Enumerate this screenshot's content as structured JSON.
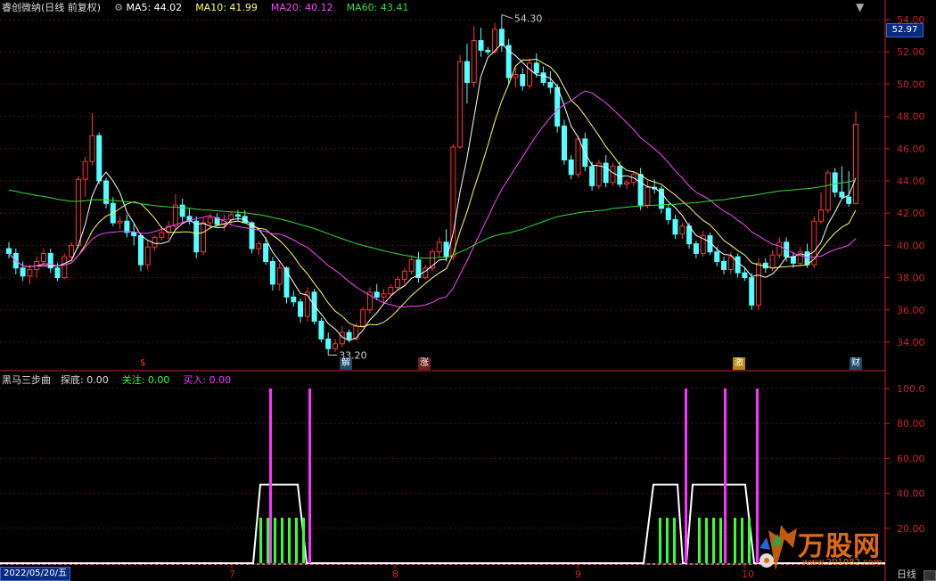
{
  "header": {
    "title": "睿创微纳(日线 前复权)",
    "ma5": "MA5: 44.02",
    "ma10": "MA10: 41.99",
    "ma20": "MA20: 40.12",
    "ma60": "MA60: 43.41",
    "close": "▼"
  },
  "indicator": {
    "name": "黑马三步曲",
    "tandi": "探底: 0.00",
    "guanzhu": "关注: 0.00",
    "mairu": "买入: 0.00"
  },
  "current_price": "52.97",
  "high_label": "54.30",
  "low_label": "33.20",
  "tags": [
    {
      "text": "$",
      "color": "#ff3333"
    },
    {
      "text": "解",
      "color": "#66ccff"
    },
    {
      "text": "涨",
      "color": "#ff6666"
    },
    {
      "text": "激",
      "color": "#ffcc33"
    },
    {
      "text": "财",
      "color": "#66ccff"
    }
  ],
  "date_label": "2022/05/20/五",
  "period": "日线",
  "month_labels": [
    "7",
    "8",
    "9",
    "10"
  ],
  "watermark": {
    "brand": "万股网",
    "url": "www.201082.com"
  },
  "colors": {
    "up": "#ff3333",
    "down": "#54ffff",
    "ma5": "#ffffff",
    "ma10": "#ffff66",
    "ma20": "#ff44ff",
    "ma60": "#33dd33",
    "axis": "#cc2222",
    "grid": "#5a1010",
    "magenta_bar": "#ff33ff",
    "green_bar": "#33ff33"
  },
  "chart_data": [
    {
      "type": "candlestick",
      "title": "睿创微纳(日线 前复权)",
      "y_ticks": [
        "54.00",
        "52.00",
        "50.00",
        "48.00",
        "46.00",
        "44.00",
        "42.00",
        "40.00",
        "38.00",
        "36.00",
        "34.00"
      ],
      "ylim": [
        33.0,
        54.5
      ],
      "candles": [
        [
          39.8,
          40.2,
          39.2,
          39.5
        ],
        [
          39.5,
          39.8,
          38.2,
          38.6
        ],
        [
          38.6,
          39.0,
          37.8,
          38.1
        ],
        [
          38.1,
          38.8,
          37.6,
          38.5
        ],
        [
          38.5,
          39.3,
          38.0,
          39.0
        ],
        [
          39.0,
          39.8,
          38.8,
          39.5
        ],
        [
          39.5,
          39.8,
          38.3,
          38.6
        ],
        [
          38.6,
          38.9,
          37.8,
          38.0
        ],
        [
          38.0,
          39.5,
          37.9,
          39.3
        ],
        [
          39.3,
          40.2,
          39.0,
          40.0
        ],
        [
          40.0,
          44.3,
          39.8,
          44.1
        ],
        [
          44.1,
          45.5,
          43.0,
          45.2
        ],
        [
          45.2,
          48.2,
          45.0,
          46.8
        ],
        [
          46.8,
          47.0,
          43.8,
          44.0
        ],
        [
          44.0,
          44.2,
          42.3,
          42.6
        ],
        [
          42.6,
          43.0,
          41.2,
          41.4
        ],
        [
          41.4,
          41.8,
          41.0,
          41.5
        ],
        [
          41.5,
          41.9,
          40.5,
          40.8
        ],
        [
          40.8,
          41.3,
          40.0,
          40.6
        ],
        [
          40.6,
          40.8,
          38.4,
          38.8
        ],
        [
          38.8,
          40.3,
          38.5,
          39.9
        ],
        [
          39.9,
          40.6,
          39.7,
          40.5
        ],
        [
          40.5,
          41.2,
          40.3,
          40.8
        ],
        [
          40.8,
          41.5,
          40.4,
          41.2
        ],
        [
          41.2,
          43.2,
          41.0,
          42.5
        ],
        [
          42.5,
          42.9,
          41.4,
          41.8
        ],
        [
          41.8,
          42.3,
          41.3,
          41.5
        ],
        [
          41.5,
          41.8,
          39.2,
          39.6
        ],
        [
          39.6,
          41.7,
          39.4,
          41.4
        ],
        [
          41.4,
          42.0,
          41.0,
          41.7
        ],
        [
          41.7,
          42.0,
          41.2,
          41.3
        ],
        [
          41.3,
          41.9,
          40.9,
          41.6
        ],
        [
          41.6,
          42.1,
          41.3,
          41.9
        ],
        [
          41.9,
          42.2,
          41.5,
          41.8
        ],
        [
          41.8,
          42.2,
          41.5,
          41.4
        ],
        [
          41.4,
          41.5,
          39.5,
          39.8
        ],
        [
          39.8,
          40.3,
          39.4,
          40.1
        ],
        [
          40.1,
          40.5,
          38.8,
          39.0
        ],
        [
          39.0,
          39.3,
          37.2,
          37.6
        ],
        [
          37.6,
          38.9,
          37.2,
          38.6
        ],
        [
          38.6,
          38.7,
          36.4,
          36.8
        ],
        [
          36.8,
          37.2,
          36.2,
          36.5
        ],
        [
          36.5,
          36.7,
          35.2,
          35.6
        ],
        [
          35.6,
          37.4,
          35.3,
          37.1
        ],
        [
          37.1,
          37.3,
          35.1,
          35.3
        ],
        [
          35.3,
          35.5,
          34.0,
          34.2
        ],
        [
          34.2,
          34.6,
          33.2,
          33.6
        ],
        [
          33.6,
          34.2,
          33.4,
          33.9
        ],
        [
          33.9,
          35.0,
          33.7,
          34.6
        ],
        [
          34.6,
          34.8,
          34.0,
          34.2
        ],
        [
          34.2,
          35.2,
          34.1,
          35.0
        ],
        [
          35.0,
          36.2,
          34.9,
          36.0
        ],
        [
          36.0,
          37.4,
          35.8,
          37.1
        ],
        [
          37.1,
          37.6,
          36.6,
          36.8
        ],
        [
          36.8,
          37.3,
          36.4,
          37.0
        ],
        [
          37.0,
          37.6,
          36.8,
          37.4
        ],
        [
          37.4,
          38.1,
          37.2,
          37.9
        ],
        [
          37.9,
          38.6,
          37.6,
          38.4
        ],
        [
          38.4,
          39.4,
          38.2,
          39.1
        ],
        [
          39.1,
          39.6,
          37.7,
          38.0
        ],
        [
          38.0,
          38.8,
          37.9,
          38.6
        ],
        [
          38.6,
          39.8,
          38.4,
          39.6
        ],
        [
          39.6,
          40.5,
          39.3,
          40.2
        ],
        [
          40.2,
          41.0,
          39.0,
          39.3
        ],
        [
          39.3,
          46.3,
          39.1,
          46.1
        ],
        [
          46.1,
          51.8,
          46.0,
          51.4
        ],
        [
          51.4,
          52.5,
          48.8,
          50.1
        ],
        [
          50.1,
          53.6,
          49.8,
          52.7
        ],
        [
          52.7,
          53.5,
          51.7,
          52.1
        ],
        [
          52.1,
          52.3,
          51.8,
          52.0
        ],
        [
          52.0,
          53.8,
          51.9,
          53.4
        ],
        [
          53.4,
          54.3,
          52.0,
          52.4
        ],
        [
          52.4,
          52.8,
          50.0,
          50.4
        ],
        [
          50.4,
          51.0,
          49.8,
          50.6
        ],
        [
          50.6,
          51.0,
          49.6,
          49.9
        ],
        [
          49.9,
          51.6,
          49.7,
          51.3
        ],
        [
          51.3,
          51.9,
          50.4,
          50.7
        ],
        [
          50.7,
          51.1,
          49.9,
          50.1
        ],
        [
          50.1,
          50.8,
          49.4,
          49.8
        ],
        [
          49.8,
          50.0,
          47.0,
          47.4
        ],
        [
          47.4,
          47.8,
          45.0,
          45.3
        ],
        [
          45.3,
          45.6,
          44.1,
          44.4
        ],
        [
          44.4,
          46.8,
          44.2,
          46.6
        ],
        [
          46.6,
          47.0,
          44.6,
          44.9
        ],
        [
          44.9,
          45.2,
          43.4,
          43.7
        ],
        [
          43.7,
          45.3,
          43.5,
          45.1
        ],
        [
          45.1,
          45.6,
          43.6,
          43.9
        ],
        [
          43.9,
          45.1,
          43.7,
          44.9
        ],
        [
          44.9,
          45.2,
          43.6,
          43.8
        ],
        [
          43.8,
          44.1,
          43.5,
          43.9
        ],
        [
          43.9,
          44.6,
          43.7,
          44.4
        ],
        [
          44.4,
          44.8,
          42.2,
          42.5
        ],
        [
          42.5,
          44.0,
          42.3,
          43.6
        ],
        [
          43.6,
          44.1,
          43.2,
          43.5
        ],
        [
          43.5,
          43.7,
          42.0,
          42.3
        ],
        [
          42.3,
          42.6,
          41.3,
          41.6
        ],
        [
          41.6,
          41.9,
          40.4,
          40.7
        ],
        [
          40.7,
          41.4,
          40.4,
          41.2
        ],
        [
          41.2,
          41.4,
          39.8,
          40.1
        ],
        [
          40.1,
          40.3,
          39.2,
          39.5
        ],
        [
          39.5,
          40.9,
          39.3,
          40.6
        ],
        [
          40.6,
          40.8,
          39.4,
          39.6
        ],
        [
          39.6,
          39.9,
          38.7,
          39.0
        ],
        [
          39.0,
          39.3,
          38.2,
          38.5
        ],
        [
          38.5,
          39.6,
          38.2,
          39.3
        ],
        [
          39.3,
          39.5,
          38.0,
          38.3
        ],
        [
          38.3,
          38.6,
          37.8,
          38.0
        ],
        [
          38.0,
          38.3,
          36.0,
          36.3
        ],
        [
          36.3,
          39.2,
          36.0,
          38.9
        ],
        [
          38.9,
          39.2,
          38.3,
          38.6
        ],
        [
          38.6,
          39.7,
          38.4,
          39.4
        ],
        [
          39.4,
          40.5,
          39.2,
          40.2
        ],
        [
          40.2,
          40.5,
          39.0,
          39.3
        ],
        [
          39.3,
          39.6,
          38.6,
          38.9
        ],
        [
          38.9,
          39.9,
          38.7,
          39.6
        ],
        [
          39.6,
          40.1,
          38.6,
          38.8
        ],
        [
          38.8,
          41.8,
          38.6,
          41.5
        ],
        [
          41.5,
          43.3,
          41.3,
          42.2
        ],
        [
          42.2,
          44.7,
          42.0,
          44.5
        ],
        [
          44.5,
          44.8,
          43.0,
          43.3
        ],
        [
          43.3,
          44.9,
          42.9,
          43.0
        ],
        [
          43.0,
          44.6,
          42.4,
          42.6
        ],
        [
          42.6,
          48.3,
          42.5,
          47.5
        ]
      ],
      "moving_averages": [
        "MA5",
        "MA10",
        "MA20",
        "MA60"
      ]
    },
    {
      "type": "bar",
      "title": "黑马三步曲",
      "y_ticks": [
        "100.0",
        "80.00",
        "60.00",
        "40.00",
        "20.00"
      ],
      "ylim": [
        0,
        100
      ],
      "series": [
        {
          "name": "探底",
          "values": [
            0.0
          ]
        },
        {
          "name": "关注",
          "values": [
            0.0
          ]
        },
        {
          "name": "买入",
          "values": [
            0.0
          ]
        }
      ]
    }
  ]
}
